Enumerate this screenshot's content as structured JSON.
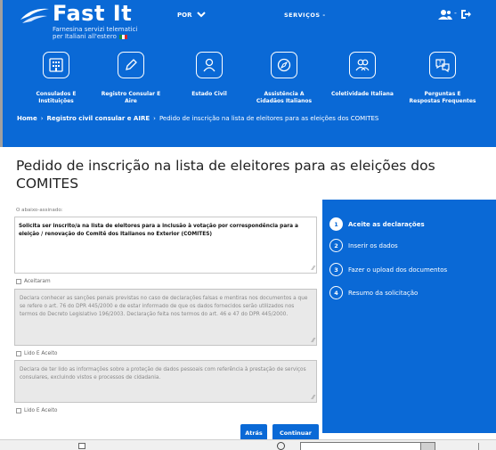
{
  "header": {
    "logo_title": "Fast It",
    "logo_sub_line1": "Farnesina servizi telematici",
    "logo_sub_line2": "per Italiani all'estero",
    "language": "POR",
    "services": "SERVIÇOS",
    "services_caret": "-",
    "user_separator": "-"
  },
  "nav": [
    {
      "label": "Consulados E Instituições",
      "icon": "building-icon"
    },
    {
      "label": "Registro Consular E Aire",
      "icon": "pencil-icon"
    },
    {
      "label": "Estado Civil",
      "icon": "person-icon"
    },
    {
      "label": "Assistência A Cidadãos Italianos",
      "icon": "compass-icon"
    },
    {
      "label": "Coletividade Italiana",
      "icon": "group-icon"
    },
    {
      "label": "Perguntas E Respostas Frequentes",
      "icon": "chat-question-icon"
    }
  ],
  "breadcrumb": {
    "home": "Home",
    "section": "Registro civil consular e AIRE",
    "current": "Pedido de inscrição na lista de eleitores para as eleições dos COMITES",
    "separator": "›"
  },
  "page_title": "Pedido de inscrição na lista de eleitores para as eleições dos COMITES",
  "form": {
    "undersigned_label": "O abaixo-assinado:",
    "request_text": "Solicita ser inscrito/a na lista de eleitores para a inclusão à votação por correspondência para a eleição / renovação do Comitê dos Italianos no Exterior (COMITES)",
    "check1_label": "Aceitaram",
    "declaration_text": "Declara conhecer as sanções penais previstas no caso de declarações falsas e mentiras nos documentos a que se refere o art. 76 do DPR 445/2000 e de estar informado de que os dados fornecidos serão utilizados nos termos do Decreto Legislativo 196/2003. Declaração feita nos termos do art. 46 e 47 do DPR 445/2000.",
    "check2_label": "Lido E Aceito",
    "privacy_text": "Declara de ter lido as informações sobre a proteção de dados pessoais com referência à prestação de serviços consulares, excluindo vistos e processos de cidadania.",
    "check3_label": "Lido E Aceito",
    "resize_glyph": "⁄⁄"
  },
  "buttons": {
    "back": "Atrás",
    "continue": "Continuar"
  },
  "steps": [
    {
      "number": "1",
      "label": "Aceite as declarações",
      "active": true
    },
    {
      "number": "2",
      "label": "Inserir os dados",
      "active": false
    },
    {
      "number": "3",
      "label": "Fazer o upload dos documentos",
      "active": false
    },
    {
      "number": "4",
      "label": "Resumo da solicitação",
      "active": false
    }
  ],
  "colors": {
    "primary": "#0a69d6",
    "disabled_field": "#e9e9e9"
  }
}
